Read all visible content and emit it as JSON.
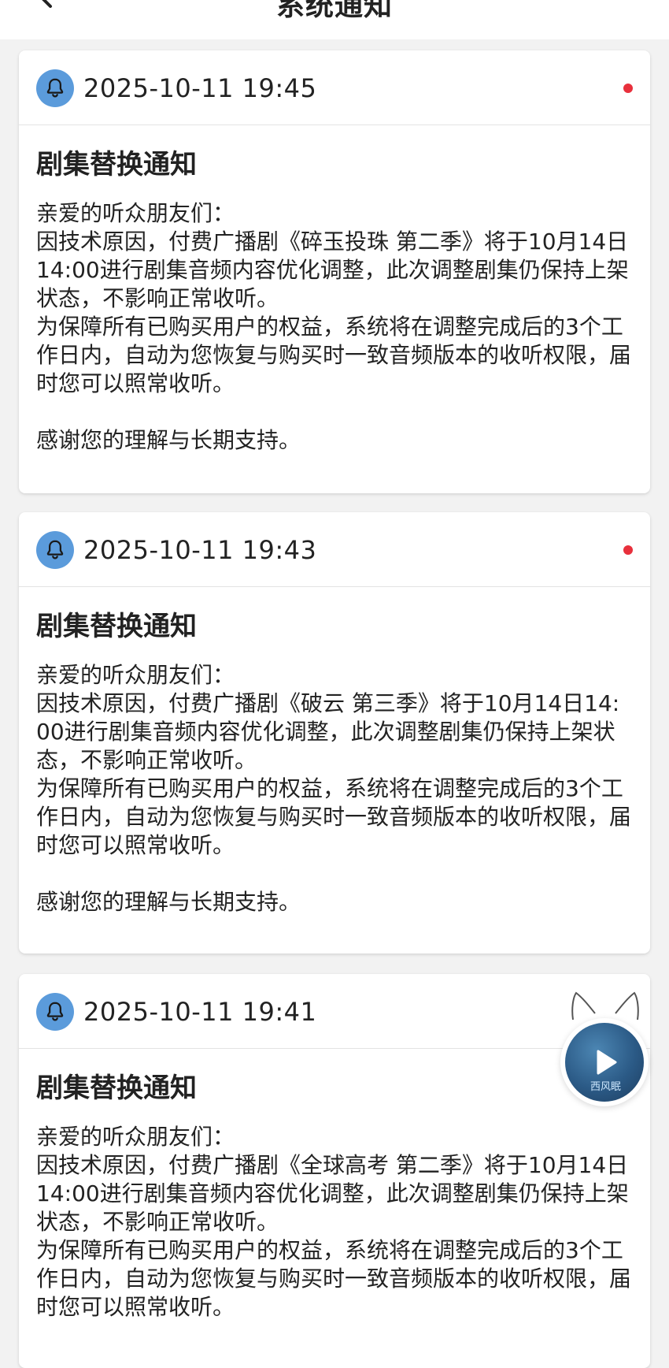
{
  "header": {
    "title": "系统通知"
  },
  "notifications": [
    {
      "timestamp": "2025-10-11 19:45",
      "title": "剧集替换通知",
      "greeting": "亲爱的听众朋友们：",
      "body1": "因技术原因，付费广播剧《碎玉投珠 第二季》将于10月14日14:00进行剧集音频内容优化调整，此次调整剧集仍保持上架状态，不影响正常收听。",
      "body2": "为保障所有已购买用户的权益，系统将在调整完成后的3个工作日内，自动为您恢复与购买时一致音频版本的收听权限，届时您可以照常收听。",
      "closing": "感谢您的理解与长期支持。",
      "unread": true
    },
    {
      "timestamp": "2025-10-11 19:43",
      "title": "剧集替换通知",
      "greeting": "亲爱的听众朋友们：",
      "body1": "因技术原因，付费广播剧《破云 第三季》将于10月14日14:00进行剧集音频内容优化调整，此次调整剧集仍保持上架状态，不影响正常收听。",
      "body2": "为保障所有已购买用户的权益，系统将在调整完成后的3个工作日内，自动为您恢复与购买时一致音频版本的收听权限，届时您可以照常收听。",
      "closing": "感谢您的理解与长期支持。",
      "unread": true
    },
    {
      "timestamp": "2025-10-11 19:41",
      "title": "剧集替换通知",
      "greeting": "亲爱的听众朋友们：",
      "body1": "因技术原因，付费广播剧《全球高考 第二季》将于10月14日14:00进行剧集音频内容优化调整，此次调整剧集仍保持上架状态，不影响正常收听。",
      "body2": "为保障所有已购买用户的权益，系统将在调整完成后的3个工作日内，自动为您恢复与购买时一致音频版本的收听权限，届时您可以照常收听。",
      "unread": true
    }
  ],
  "player": {
    "cover_text": "西风眠",
    "icon": "play-icon"
  },
  "colors": {
    "accent_blue": "#5b9bdb",
    "unread_red": "#e8303c",
    "background": "#f2f2f2"
  }
}
